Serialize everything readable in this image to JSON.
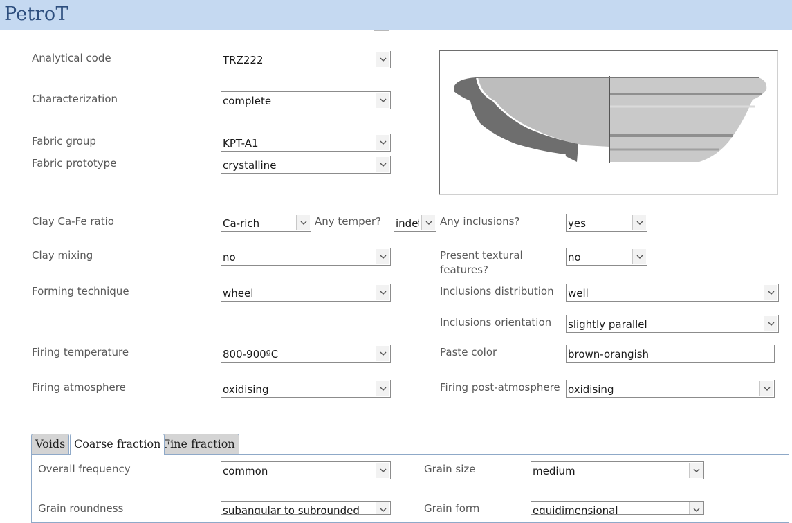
{
  "app": {
    "title": "PetroT"
  },
  "form": {
    "analytical_code": {
      "label": "Analytical code",
      "value": "TRZ222"
    },
    "characterization": {
      "label": "Characterization",
      "value": "complete"
    },
    "fabric_group": {
      "label": "Fabric group",
      "value": "KPT-A1"
    },
    "fabric_prototype": {
      "label": "Fabric prototype",
      "value": "crystalline"
    },
    "clay_ca_fe_ratio": {
      "label": "Clay Ca-Fe ratio",
      "value": "Ca-rich"
    },
    "any_temper": {
      "label": "Any temper?",
      "value": "indet"
    },
    "any_inclusions": {
      "label": "Any inclusions?",
      "value": "yes"
    },
    "clay_mixing": {
      "label": "Clay mixing",
      "value": "no"
    },
    "present_textural_features": {
      "label": "Present textural features?",
      "value": "no"
    },
    "forming_technique": {
      "label": "Forming technique",
      "value": "wheel"
    },
    "inclusions_distribution": {
      "label": "Inclusions distribution",
      "value": "well"
    },
    "inclusions_orientation": {
      "label": "Inclusions orientation",
      "value": "slightly parallel"
    },
    "firing_temperature": {
      "label": "Firing temperature",
      "value": "800-900ºC"
    },
    "paste_color": {
      "label": "Paste color",
      "value": "brown-orangish"
    },
    "firing_atmosphere": {
      "label": "Firing atmosphere",
      "value": "oxidising"
    },
    "firing_post_atmosphere": {
      "label": "Firing post-atmosphere",
      "value": "oxidising"
    }
  },
  "tabs": [
    {
      "label": "Voids",
      "active": false
    },
    {
      "label": "Coarse fraction",
      "active": true
    },
    {
      "label": "Fine fraction",
      "active": false
    }
  ],
  "coarse_fraction": {
    "overall_frequency": {
      "label": "Overall frequency",
      "value": "common"
    },
    "grain_size": {
      "label": "Grain size",
      "value": "medium"
    },
    "grain_roundness": {
      "label": "Grain roundness",
      "value": "subangular to subrounded"
    },
    "grain_form": {
      "label": "Grain form",
      "value": "equidimensional"
    }
  },
  "colors": {
    "title_bar": "#c5d9f1",
    "title_text": "#2d4e7e",
    "label_text": "#595959",
    "tab_border": "#8fa9c8"
  },
  "icons": {
    "dropdown": "chevron-down-icon",
    "vessel": "vessel-profile-drawing"
  }
}
